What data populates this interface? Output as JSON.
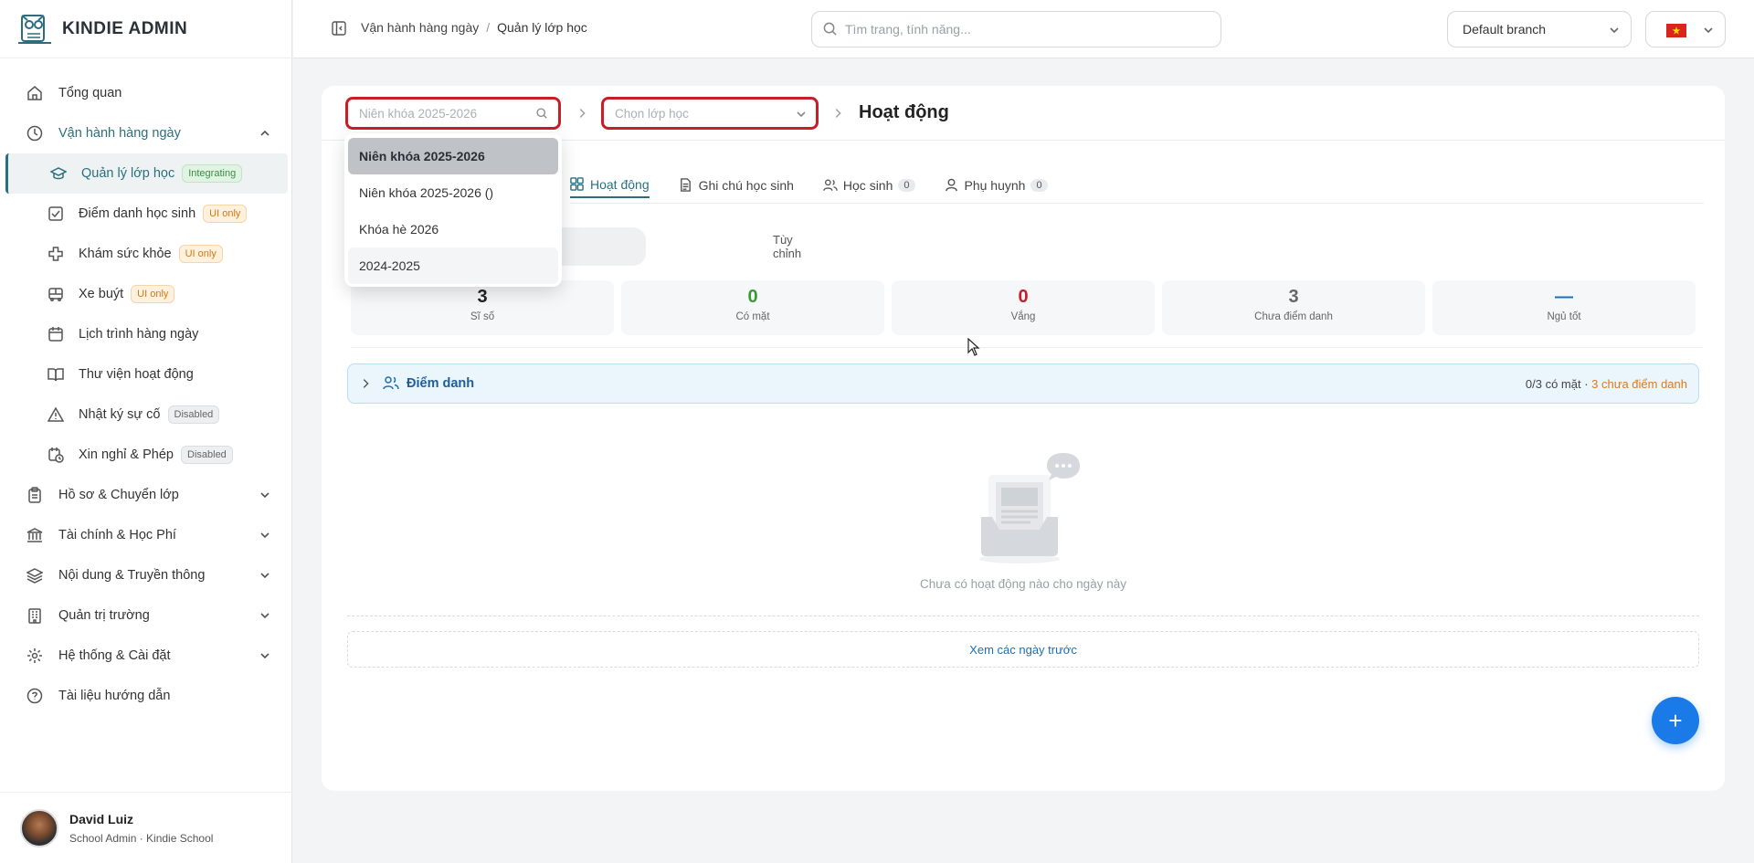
{
  "brand": {
    "name": "KINDIE ADMIN"
  },
  "sidebar": {
    "items": [
      {
        "label": "Tổng quan",
        "icon": "home-icon"
      },
      {
        "label": "Vận hành hàng ngày",
        "icon": "clock-icon"
      },
      {
        "label": "Hồ sơ & Chuyển lớp",
        "icon": "clipboard-icon"
      },
      {
        "label": "Tài chính & Học Phí",
        "icon": "bank-icon"
      },
      {
        "label": "Nội dung & Truyền thông",
        "icon": "layers-icon"
      },
      {
        "label": "Quản trị trường",
        "icon": "building-icon"
      },
      {
        "label": "Hệ thống & Cài đặt",
        "icon": "gear-icon"
      },
      {
        "label": "Tài liệu hướng dẫn",
        "icon": "help-circle-icon"
      }
    ],
    "subitems": [
      {
        "label": "Quản lý lớp học",
        "tag": "Integrating"
      },
      {
        "label": "Điểm danh học sinh",
        "tag": "UI only"
      },
      {
        "label": "Khám sức khỏe",
        "tag": "UI only"
      },
      {
        "label": "Xe buýt",
        "tag": "UI only"
      },
      {
        "label": "Lịch trình hàng ngày",
        "tag": ""
      },
      {
        "label": "Thư viện hoạt động",
        "tag": ""
      },
      {
        "label": "Nhật ký sự cố",
        "tag": "Disabled"
      },
      {
        "label": "Xin nghỉ & Phép",
        "tag": "Disabled"
      }
    ]
  },
  "user": {
    "name": "David Luiz",
    "role": "School Admin · Kindie School"
  },
  "header": {
    "breadcrumb": [
      "Vận hành hàng ngày",
      "Quản lý lớp học"
    ],
    "search_placeholder": "Tìm trang, tính năng...",
    "branch": "Default branch"
  },
  "main": {
    "year_placeholder": "Niên khóa 2025-2026",
    "class_placeholder": "Chọn lớp học",
    "title": "Hoạt động",
    "tabs": [
      {
        "label": "Hoạt động",
        "count": ""
      },
      {
        "label": "Ghi chú học sinh",
        "count": ""
      },
      {
        "label": "Học sinh",
        "count": "0"
      },
      {
        "label": "Phụ huynh",
        "count": "0"
      }
    ],
    "custom_pill": "Tùy chỉnh",
    "stats": [
      {
        "value": "3",
        "label": "Sĩ số",
        "color": "#222222"
      },
      {
        "value": "0",
        "label": "Có mặt",
        "color": "#3a9a3a"
      },
      {
        "value": "0",
        "label": "Vắng",
        "color": "#c81e28"
      },
      {
        "value": "3",
        "label": "Chưa điểm danh",
        "color": "#666666"
      },
      {
        "value": "—",
        "label": "Ngủ tốt",
        "color": "#1f6fb5"
      }
    ],
    "attendance": {
      "title": "Điểm danh",
      "present": "0/3 có mặt",
      "separator": " · ",
      "pending": "3 chưa điểm danh"
    },
    "empty_text": "Chưa có hoạt động nào cho ngày này",
    "prev_days": "Xem các ngày trước",
    "fab": "+"
  },
  "dropdown": {
    "options": [
      "Niên khóa 2025-2026",
      "Niên khóa 2025-2026 ()",
      "Khóa hè 2026",
      "2024-2025"
    ]
  }
}
